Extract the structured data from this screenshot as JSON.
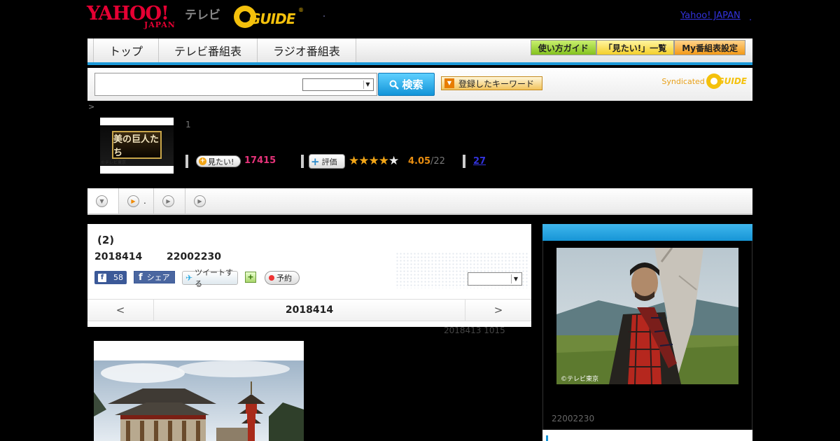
{
  "header": {
    "yahoo_logo_main": "YAHOO!",
    "yahoo_logo_sub": "JAPAN",
    "tv_label": "テレビ",
    "gguide_logo_text": "GUIDE",
    "gguide_reg": "®",
    "yahoo_japan_link": "Yahoo! JAPAN",
    "yahoo_japan_dot": "."
  },
  "nav": {
    "tabs": [
      {
        "label": "トップ"
      },
      {
        "label": "テレビ番組表"
      },
      {
        "label": "ラジオ番組表"
      }
    ],
    "right_buttons": [
      {
        "label": "使い方ガイド",
        "color": "#84c21f"
      },
      {
        "label": "「見たい!」一覧",
        "color": "#f4cf2a"
      },
      {
        "label": "My番組表設定",
        "color": "#f39a17"
      }
    ]
  },
  "search": {
    "input_value": "",
    "select_value": "",
    "button_label": "検索",
    "keyword_button_label": "登録したキーワード",
    "syndicated_label": "Syndicated",
    "syndicated_logo_text": "GUIDE"
  },
  "program": {
    "breadcrumb_arrow": ">",
    "thumb_title": "美の巨人たち",
    "thumb_credit": "©テレビ東京",
    "count_text": "1",
    "mitai_label": "見たい!",
    "mitai_count": "17415",
    "hyouka_label": "評価",
    "rating": 4.05,
    "stars_filled": "★★★★",
    "stars_empty": "★",
    "rating_value": "4.05",
    "rating_count": "/22",
    "review_link": "27"
  },
  "subtabs": [
    {
      "label": "",
      "icon": "chevron-down-icon"
    },
    {
      "label": ".",
      "icon": "play-orange-icon"
    },
    {
      "label": "",
      "icon": "play-icon"
    },
    {
      "label": "",
      "icon": "play-icon"
    }
  ],
  "episode": {
    "title": "(2)",
    "date": "2018414",
    "time": "22002230",
    "fb_count": "58",
    "fb_share_label": "シェア",
    "tweet_label": "ツイートする",
    "yoyaku_label": "予約",
    "panel_select_value": ""
  },
  "date_nav": {
    "prev": "<",
    "current": "2018414",
    "next": ">"
  },
  "updated_note": "2018413  1015",
  "sidebar": {
    "photo_credit": "©テレビ東京",
    "time_text": "22002230"
  },
  "colors": {
    "accent_blue": "#1d9ad9",
    "yahoo_red": "#e60033",
    "gguide_yellow": "#f4c10c",
    "mitai_pink": "#e6337a",
    "rating_orange": "#e88d10"
  }
}
